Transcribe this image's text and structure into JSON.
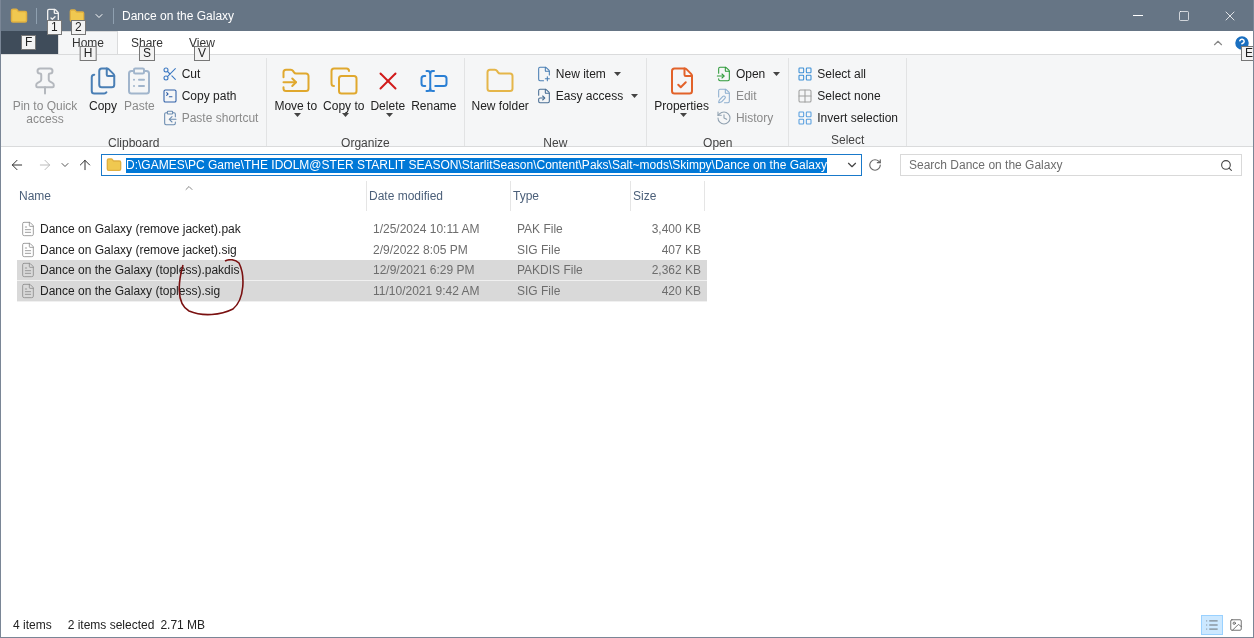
{
  "window": {
    "title": "Dance on the Galaxy",
    "quick_access_keytips": [
      "1",
      "2"
    ],
    "help_keytip": "E"
  },
  "ribbon_tabs": [
    {
      "kind": "file",
      "keytip": "F",
      "selected": false
    },
    {
      "kind": "tab",
      "label": "Home",
      "keytip": "H",
      "selected": true
    },
    {
      "kind": "tab",
      "label": "Share",
      "keytip": "S",
      "selected": false
    },
    {
      "kind": "tab",
      "label": "View",
      "keytip": "V",
      "selected": false
    }
  ],
  "ribbon_groups": [
    {
      "label": "Clipboard",
      "items": [
        {
          "kind": "large",
          "label": "Pin to Quick access",
          "disabled": true,
          "dropdown": false
        },
        {
          "kind": "large",
          "label": "Copy",
          "disabled": false,
          "dropdown": false
        },
        {
          "kind": "large",
          "label": "Paste",
          "disabled": true,
          "dropdown": false
        },
        {
          "kind": "small",
          "label": "Cut",
          "disabled": false,
          "dropdown": false
        },
        {
          "kind": "small",
          "label": "Copy path",
          "disabled": false,
          "dropdown": false
        },
        {
          "kind": "small",
          "label": "Paste shortcut",
          "disabled": true,
          "dropdown": false
        }
      ]
    },
    {
      "label": "Organize",
      "items": [
        {
          "kind": "large",
          "label": "Move to",
          "disabled": false,
          "dropdown": true
        },
        {
          "kind": "large",
          "label": "Copy to",
          "disabled": false,
          "dropdown": true
        },
        {
          "kind": "large",
          "label": "Delete",
          "disabled": false,
          "dropdown": true
        },
        {
          "kind": "large",
          "label": "Rename",
          "disabled": false,
          "dropdown": false
        }
      ]
    },
    {
      "label": "New",
      "items": [
        {
          "kind": "large",
          "label": "New folder",
          "disabled": false,
          "dropdown": false
        },
        {
          "kind": "small",
          "label": "New item",
          "disabled": false,
          "dropdown": true
        },
        {
          "kind": "small",
          "label": "Easy access",
          "disabled": false,
          "dropdown": true
        }
      ]
    },
    {
      "label": "Open",
      "items": [
        {
          "kind": "large",
          "label": "Properties",
          "disabled": false,
          "dropdown": true
        },
        {
          "kind": "small",
          "label": "Open",
          "disabled": false,
          "dropdown": true
        },
        {
          "kind": "small",
          "label": "Edit",
          "disabled": true,
          "dropdown": false
        },
        {
          "kind": "small",
          "label": "History",
          "disabled": true,
          "dropdown": false
        }
      ]
    },
    {
      "label": "Select",
      "items": [
        {
          "kind": "small",
          "label": "Select all",
          "disabled": false,
          "dropdown": false
        },
        {
          "kind": "small",
          "label": "Select none",
          "disabled": false,
          "dropdown": false
        },
        {
          "kind": "small",
          "label": "Invert selection",
          "disabled": false,
          "dropdown": false
        }
      ]
    }
  ],
  "address_bar": {
    "path": "D:\\GAMES\\PC Game\\THE IDOLM@STER STARLIT SEASON\\StarlitSeason\\Content\\Paks\\Salt~mods\\Skimpy\\Dance on the Galaxy",
    "selected": true
  },
  "search": {
    "placeholder": "Search Dance on the Galaxy"
  },
  "table": {
    "columns": [
      "Name",
      "Date modified",
      "Type",
      "Size"
    ],
    "rows": [
      {
        "name": "Dance on Galaxy (remove jacket).pak",
        "date": "1/25/2024 10:11 AM",
        "type": "PAK File",
        "size": "3,400 KB",
        "selected": false
      },
      {
        "name": "Dance on Galaxy (remove jacket).sig",
        "date": "2/9/2022 8:05 PM",
        "type": "SIG File",
        "size": "407 KB",
        "selected": false
      },
      {
        "name": "Dance on the Galaxy (topless).pakdis",
        "date": "12/9/2021 6:29 PM",
        "type": "PAKDIS File",
        "size": "2,362 KB",
        "selected": true
      },
      {
        "name": "Dance on the Galaxy (topless).sig",
        "date": "11/10/2021 9:42 AM",
        "type": "SIG File",
        "size": "420 KB",
        "selected": true
      }
    ]
  },
  "status_bar": {
    "item_count": "4 items",
    "selection": "2 items selected",
    "selection_size": "2.71 MB",
    "views": [
      {
        "kind": "details",
        "selected": true
      },
      {
        "kind": "large_icons",
        "selected": false
      }
    ]
  }
}
